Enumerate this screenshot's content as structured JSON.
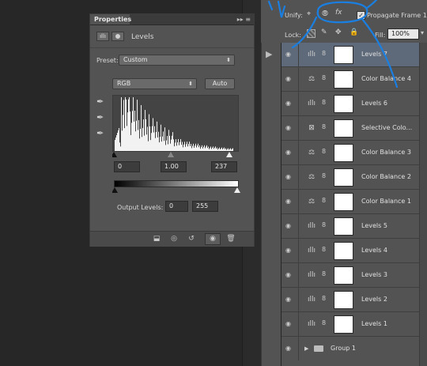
{
  "properties": {
    "tab_label": "Properties",
    "menu_glyph": "▸▸ ≡",
    "type_label": "Levels",
    "preset_label": "Preset:",
    "preset_value": "Custom",
    "channel_value": "RGB",
    "auto_label": "Auto",
    "input_black": "0",
    "input_gamma": "1.00",
    "input_white": "237",
    "output_label": "Output Levels:",
    "output_black": "0",
    "output_white": "255"
  },
  "layers": {
    "unify_label": "Unify:",
    "propagate_label": "Propagate Frame 1",
    "lock_label": "Lock:",
    "fill_label": "Fill:",
    "fill_value": "100%",
    "rows": [
      {
        "name": "Levels 7",
        "adj": "levels-icon",
        "selected": true
      },
      {
        "name": "Color Balance 4",
        "adj": "color-balance-icon"
      },
      {
        "name": "Levels 6",
        "adj": "levels-icon"
      },
      {
        "name": "Selective Colo...",
        "adj": "selective-color-icon"
      },
      {
        "name": "Color Balance 3",
        "adj": "color-balance-icon"
      },
      {
        "name": "Color Balance 2",
        "adj": "color-balance-icon"
      },
      {
        "name": "Color Balance 1",
        "adj": "color-balance-icon"
      },
      {
        "name": "Levels 5",
        "adj": "levels-icon"
      },
      {
        "name": "Levels 4",
        "adj": "levels-icon"
      },
      {
        "name": "Levels 3",
        "adj": "levels-icon"
      },
      {
        "name": "Levels 2",
        "adj": "levels-icon"
      },
      {
        "name": "Levels 1",
        "adj": "levels-icon"
      }
    ],
    "group_name": "Group 1"
  },
  "colors": {
    "annotation_blue": "#1a7fe0",
    "selected_row": "#5e6a7a"
  }
}
